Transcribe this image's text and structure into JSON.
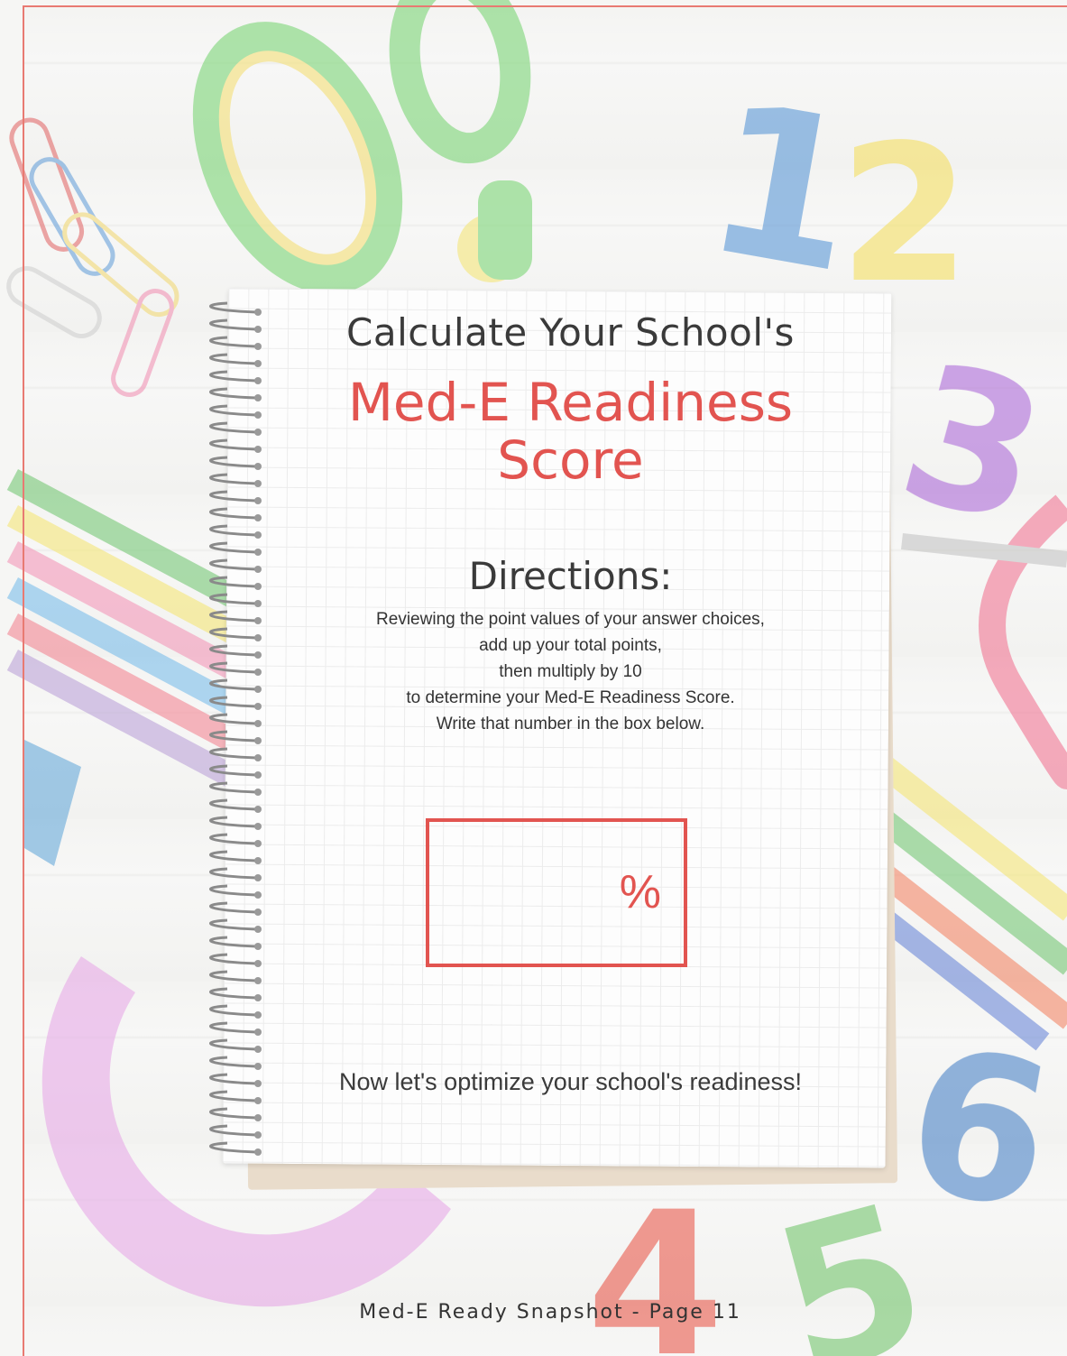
{
  "worksheet": {
    "title_line1": "Calculate Your School's",
    "title_line2": "Med-E Readiness",
    "title_line3": "Score",
    "directions_heading": "Directions:",
    "directions_lines": [
      "Reviewing the point values of your answer choices,",
      "add up your total points,",
      "then multiply by 10",
      "to determine your Med-E Readiness Score.",
      "Write that number in the box below."
    ],
    "score_box_unit": "%",
    "closing_text": "Now let's optimize your school's readiness!"
  },
  "footer": {
    "text": "Med-E Ready Snapshot - Page 11"
  },
  "colors": {
    "accent": "#e25450",
    "text": "#3a3a3a",
    "border": "#e87a72"
  },
  "background_icons": [
    "scissors-icon",
    "paper-clips-icon",
    "colored-pencils-icon",
    "protractor-icon",
    "number-1-icon",
    "number-2-icon",
    "number-3-icon",
    "number-4-icon",
    "number-5-icon",
    "number-6-icon"
  ]
}
